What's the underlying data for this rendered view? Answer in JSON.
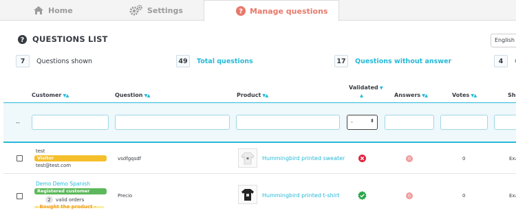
{
  "tabs": {
    "home": "Home",
    "settings": "Settings",
    "manage": "Manage questions"
  },
  "header": {
    "title": "QUESTIONS LIST",
    "language": "English ("
  },
  "stats": [
    {
      "value": "7",
      "label": "Questions shown"
    },
    {
      "value": "49",
      "label": "Total questions"
    },
    {
      "value": "17",
      "label": "Questions without answer"
    },
    {
      "value": "4",
      "label": "Q"
    }
  ],
  "columns": {
    "customer": "Customer",
    "question": "Question",
    "product": "Product",
    "validated": "Validated",
    "answers": "Answers",
    "votes": "Votes",
    "show": "Sho"
  },
  "filter": {
    "dash": "--",
    "validated_select": "-"
  },
  "rows": [
    {
      "customer_name": "test",
      "customer_badge": "Visitor",
      "customer_email": "test@test.com",
      "question": "vsdfgqsdf",
      "product": "Hummingbird printed sweater",
      "validated": "no",
      "answers": "0",
      "votes": "0",
      "show": "Exa"
    },
    {
      "customer_name": "Demo Demo Spanish",
      "customer_badge": "Registered customer",
      "valid_orders_count": "2",
      "valid_orders_label": "valid orders",
      "bought_label": "- Bought the product -",
      "question": "Precio",
      "product": "Hummingbird printed t-shirt",
      "validated": "yes",
      "answers": "0",
      "votes": "0",
      "show": "Exa"
    }
  ],
  "colors": {
    "accent": "#25b9d7",
    "active_tab": "#e8786a",
    "visitor_badge": "#f5bf2c",
    "registered_badge": "#5cb85c"
  }
}
